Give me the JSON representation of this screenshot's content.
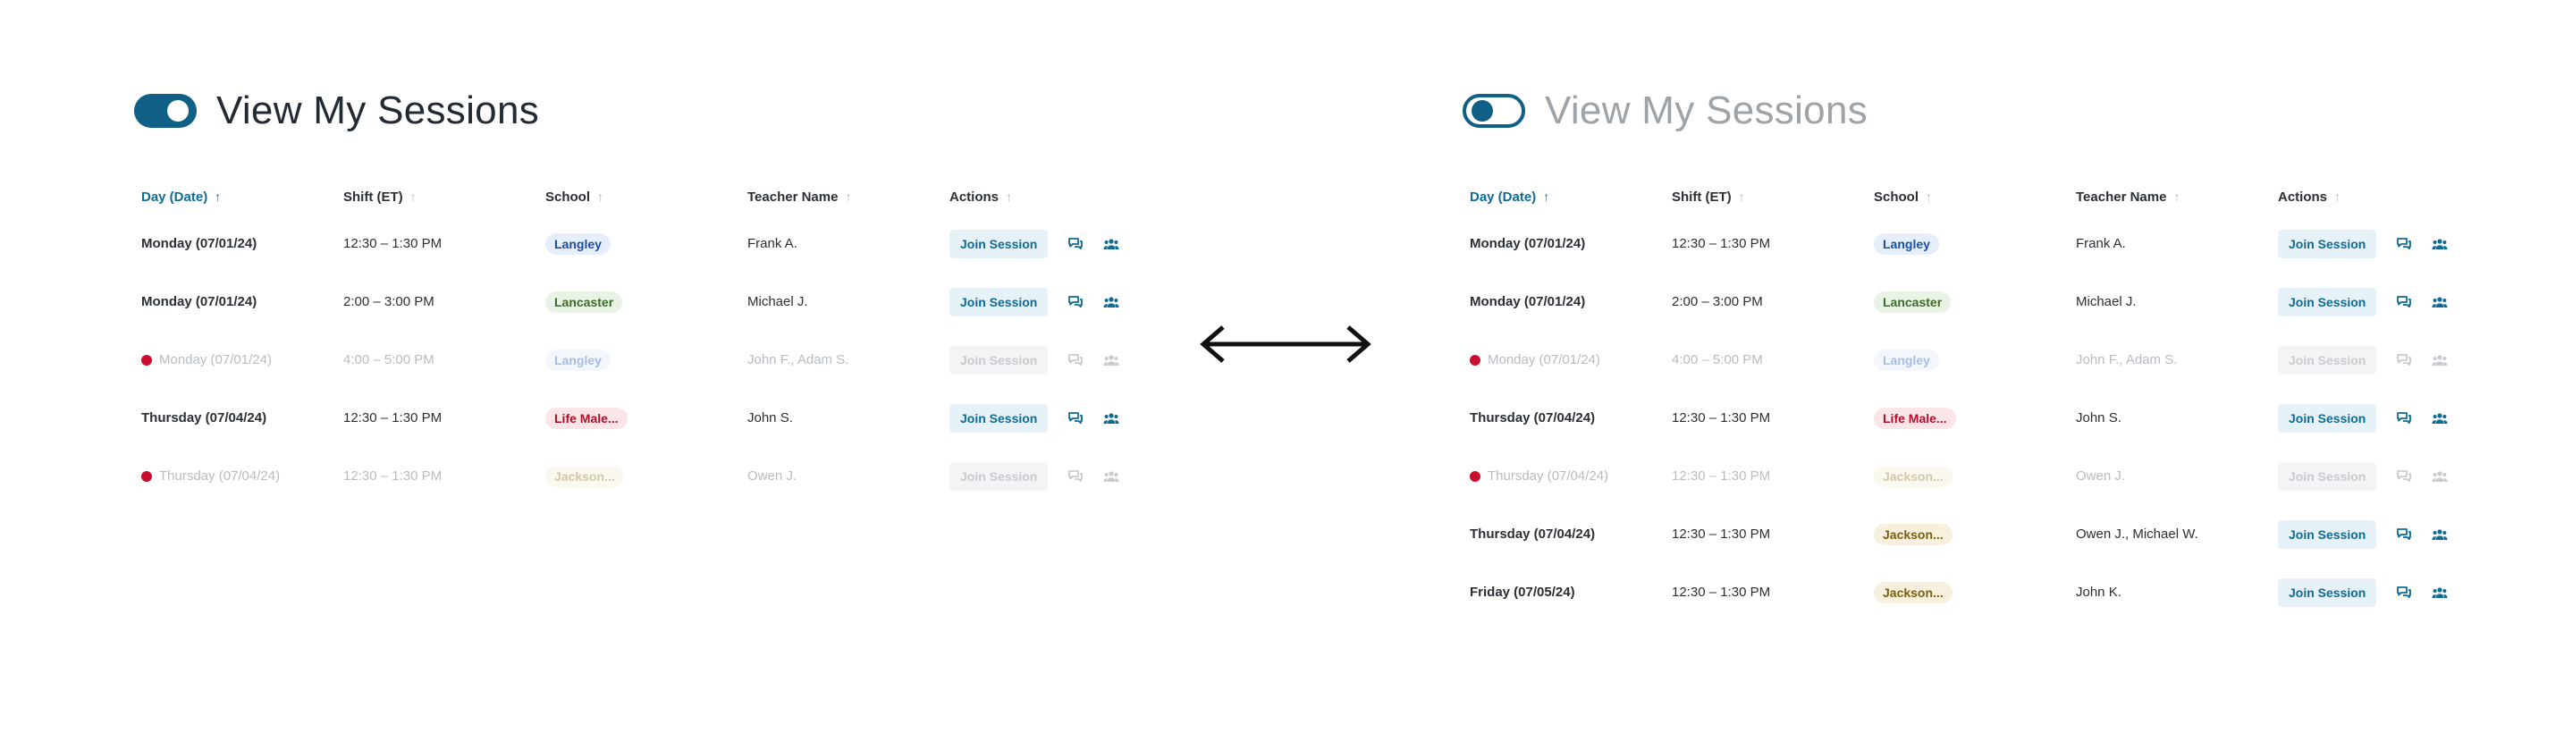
{
  "colors": {
    "accent": "#0f6b96",
    "toggle": "#0f5f86",
    "alert": "#c8102e"
  },
  "left": {
    "title": "View My Sessions",
    "toggle_state": "on",
    "columns": [
      "Day (Date)",
      "Shift (ET)",
      "School",
      "Teacher Name",
      "Actions"
    ],
    "rows": [
      {
        "day": "Monday (07/01/24)",
        "shift": "12:30 – 1:30 PM",
        "school": "Langley",
        "teacher": "Frank A.",
        "action": "Join Session"
      },
      {
        "day": "Monday (07/01/24)",
        "shift": "2:00 – 3:00 PM",
        "school": "Lancaster",
        "teacher": "Michael J.",
        "action": "Join Session"
      },
      {
        "day": "Monday (07/01/24)",
        "shift": "4:00 – 5:00 PM",
        "school": "Langley",
        "teacher": "John F., Adam S.",
        "action": "Join Session"
      },
      {
        "day": "Thursday (07/04/24)",
        "shift": "12:30 – 1:30 PM",
        "school": "Life Male...",
        "teacher": "John S.",
        "action": "Join Session"
      },
      {
        "day": "Thursday (07/04/24)",
        "shift": "12:30 – 1:30 PM",
        "school": "Jackson...",
        "teacher": "Owen J.",
        "action": "Join Session"
      }
    ]
  },
  "right": {
    "title": "View My Sessions",
    "toggle_state": "off",
    "columns": [
      "Day (Date)",
      "Shift (ET)",
      "School",
      "Teacher Name",
      "Actions"
    ],
    "rows": [
      {
        "day": "Monday (07/01/24)",
        "shift": "12:30 – 1:30 PM",
        "school": "Langley",
        "teacher": "Frank A.",
        "action": "Join Session"
      },
      {
        "day": "Monday (07/01/24)",
        "shift": "2:00 – 3:00 PM",
        "school": "Lancaster",
        "teacher": "Michael J.",
        "action": "Join Session"
      },
      {
        "day": "Monday (07/01/24)",
        "shift": "4:00 – 5:00 PM",
        "school": "Langley",
        "teacher": "John F., Adam S.",
        "action": "Join Session"
      },
      {
        "day": "Thursday (07/04/24)",
        "shift": "12:30 – 1:30 PM",
        "school": "Life Male...",
        "teacher": "John S.",
        "action": "Join Session"
      },
      {
        "day": "Thursday (07/04/24)",
        "shift": "12:30 – 1:30 PM",
        "school": "Jackson...",
        "teacher": "Owen J.",
        "action": "Join Session"
      },
      {
        "day": "Thursday (07/04/24)",
        "shift": "12:30 – 1:30 PM",
        "school": "Jackson...",
        "teacher": "Owen J., Michael W.",
        "action": "Join Session"
      },
      {
        "day": "Friday (07/05/24)",
        "shift": "12:30 – 1:30 PM",
        "school": "Jackson...",
        "teacher": "John K.",
        "action": "Join Session"
      }
    ]
  }
}
